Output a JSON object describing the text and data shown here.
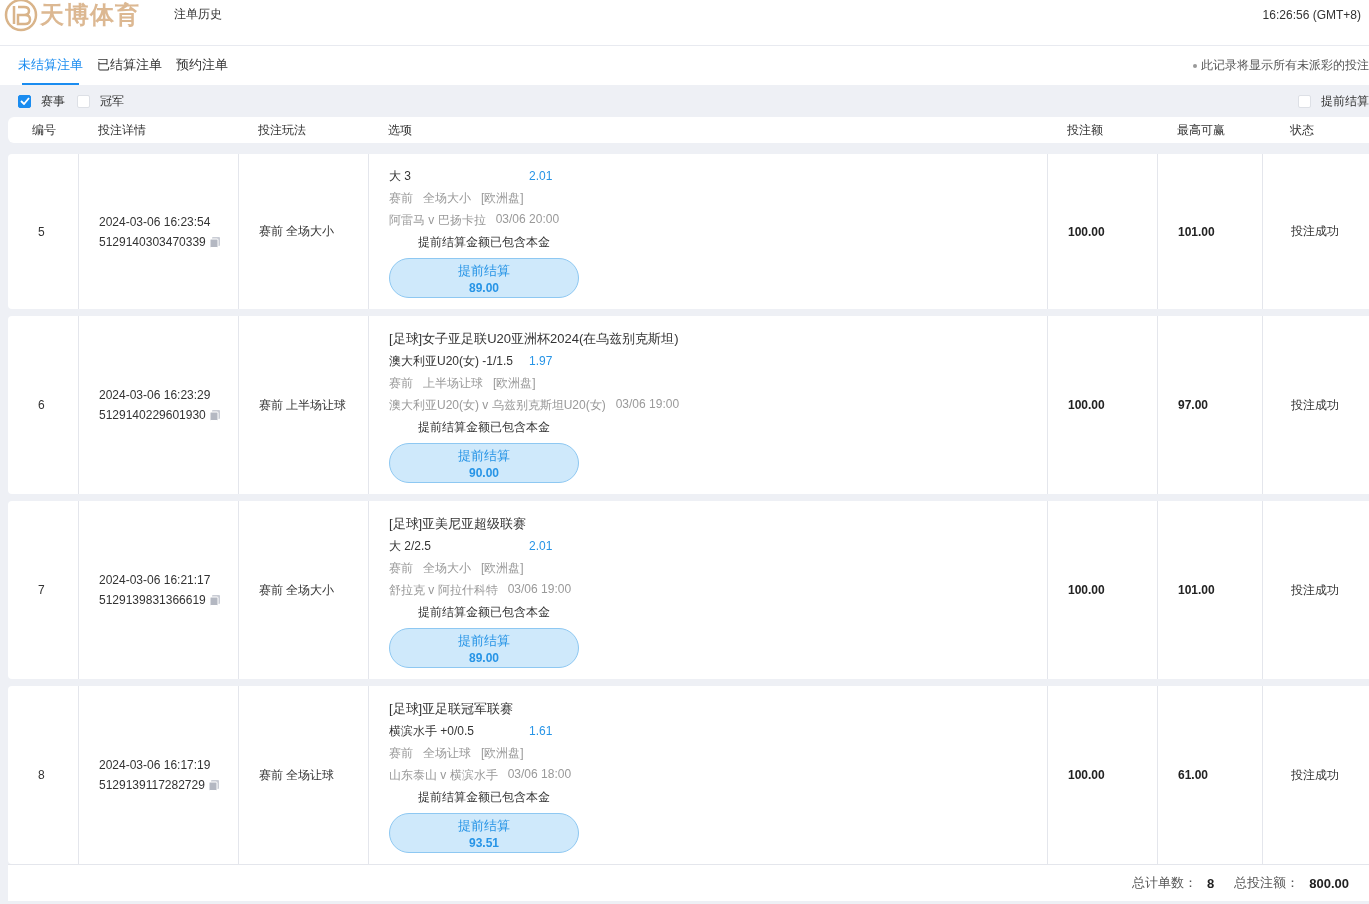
{
  "header": {
    "logo_text": "天博体育",
    "title": "注单历史",
    "clock": "16:26:56 (GMT+8)"
  },
  "tabs": [
    {
      "label": "未结算注单",
      "selected": true
    },
    {
      "label": "已结算注单",
      "selected": false
    },
    {
      "label": "预约注单",
      "selected": false
    }
  ],
  "notice": "此记录将显示所有未派彩的投注",
  "filters": [
    {
      "label": "赛事",
      "checked": true
    },
    {
      "label": "冠军",
      "checked": false
    }
  ],
  "cashout_filter": {
    "label": "提前结算",
    "checked": false
  },
  "table": {
    "columns": [
      "编号",
      "投注详情",
      "投注玩法",
      "选项",
      "投注额",
      "最高可赢",
      "状态"
    ],
    "rows": [
      {
        "no": "5",
        "time": "2024-03-06 16:23:54",
        "bet_id": "5129140303470339",
        "bet_type": "赛前 全场大小",
        "pick": "大 3",
        "odds": "2.01",
        "market": [
          "赛前",
          "全场大小",
          "[欧洲盘]"
        ],
        "match": "阿雷马 v 巴扬卡拉",
        "match_time": "03/06 20:00",
        "note": "提前结算金额已包含本金",
        "cashout_label": "提前结算",
        "cashout_amount": "89.00",
        "stake": "100.00",
        "max_win": "101.00",
        "status": "投注成功"
      },
      {
        "no": "6",
        "time": "2024-03-06 16:23:29",
        "bet_id": "5129140229601930",
        "bet_type": "赛前 上半场让球",
        "league": "[足球]女子亚足联U20亚洲杯2024(在乌兹别克斯坦)",
        "pick": "澳大利亚U20(女) -1/1.5",
        "odds": "1.97",
        "market": [
          "赛前",
          "上半场让球",
          "[欧洲盘]"
        ],
        "match": "澳大利亚U20(女) v 乌兹别克斯坦U20(女)",
        "match_time": "03/06 19:00",
        "note": "提前结算金额已包含本金",
        "cashout_label": "提前结算",
        "cashout_amount": "90.00",
        "stake": "100.00",
        "max_win": "97.00",
        "status": "投注成功"
      },
      {
        "no": "7",
        "time": "2024-03-06 16:21:17",
        "bet_id": "5129139831366619",
        "bet_type": "赛前 全场大小",
        "league": "[足球]亚美尼亚超级联赛",
        "pick": "大 2/2.5",
        "odds": "2.01",
        "market": [
          "赛前",
          "全场大小",
          "[欧洲盘]"
        ],
        "match": "舒拉克 v 阿拉什科特",
        "match_time": "03/06 19:00",
        "note": "提前结算金额已包含本金",
        "cashout_label": "提前结算",
        "cashout_amount": "89.00",
        "stake": "100.00",
        "max_win": "101.00",
        "status": "投注成功"
      },
      {
        "no": "8",
        "time": "2024-03-06 16:17:19",
        "bet_id": "5129139117282729",
        "bet_type": "赛前 全场让球",
        "league": "[足球]亚足联冠军联赛",
        "pick": "横滨水手 +0/0.5",
        "odds": "1.61",
        "market": [
          "赛前",
          "全场让球",
          "[欧洲盘]"
        ],
        "match": "山东泰山 v 横滨水手",
        "match_time": "03/06 18:00",
        "note": "提前结算金额已包含本金",
        "cashout_label": "提前结算",
        "cashout_amount": "93.51",
        "stake": "100.00",
        "max_win": "61.00",
        "status": "投注成功"
      }
    ]
  },
  "footer": {
    "count_label": "总计单数：",
    "count": "8",
    "total_label": "总投注额：",
    "total": "800.00"
  }
}
